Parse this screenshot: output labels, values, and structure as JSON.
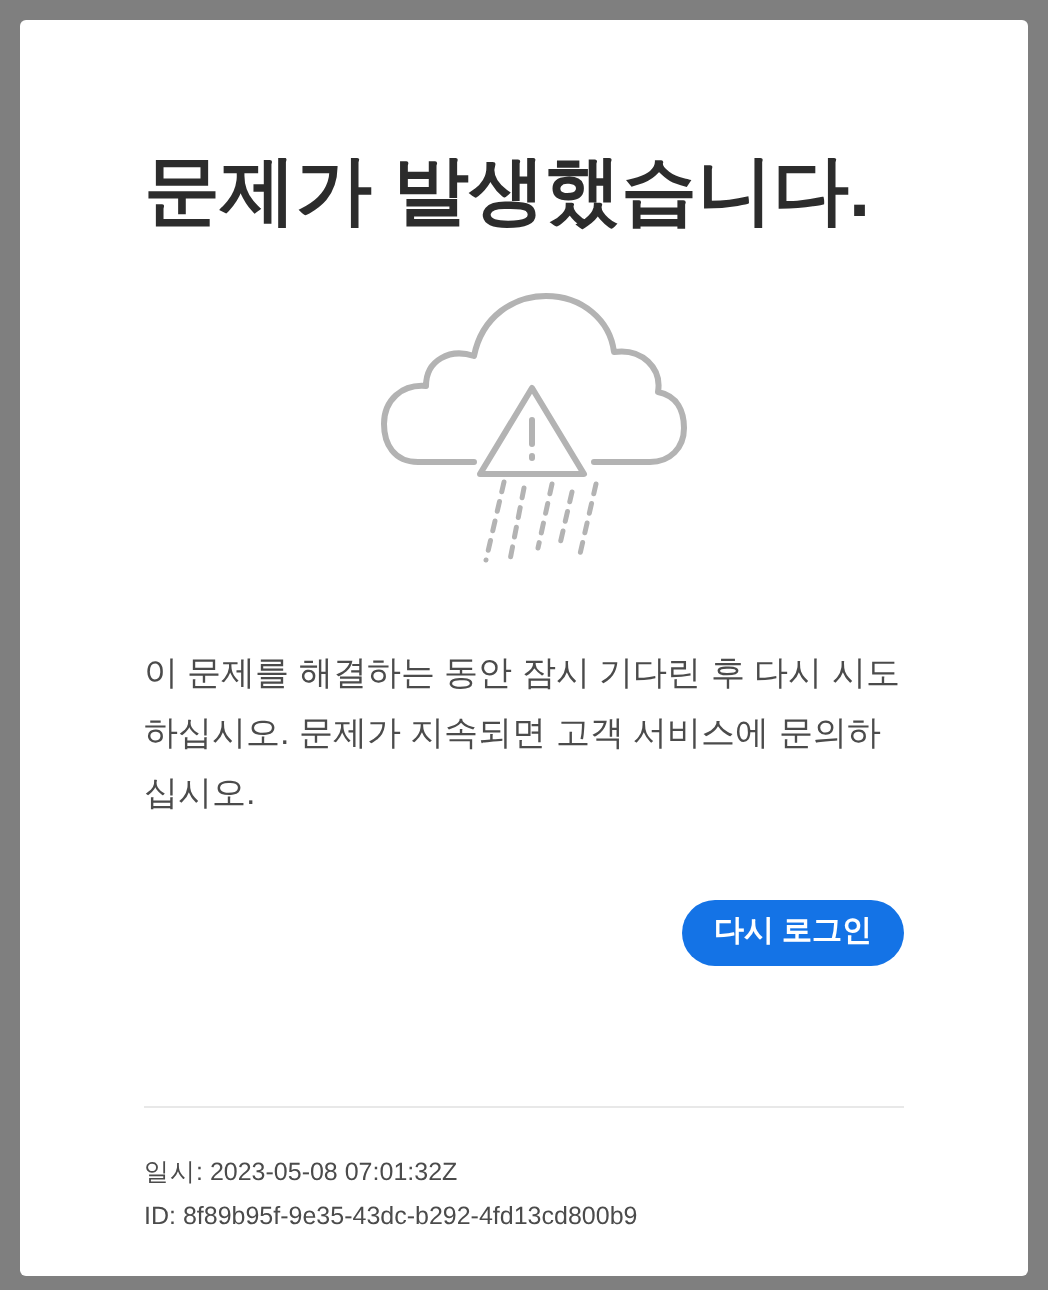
{
  "dialog": {
    "title": "문제가 발생했습니다.",
    "message": "이 문제를 해결하는 동안 잠시 기다린 후 다시 시도하십시오. 문제가 지속되면 고객 서비스에 문의하십시오.",
    "button": "다시 로그인",
    "timestamp": "일시: 2023-05-08 07:01:32Z",
    "id": "ID: 8f89b95f-9e35-43dc-b292-4fd13cd800b9"
  }
}
